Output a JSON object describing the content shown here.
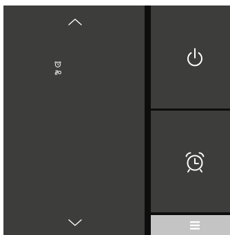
{
  "colors": {
    "panel": "#3d3d3b",
    "background": "#0d0d0d",
    "icon": "#ffffff",
    "menu_bar": "#c4c4c4"
  },
  "left_panel": {
    "up_icon": "chevron-up-icon",
    "down_icon": "chevron-down-icon",
    "status_icons": [
      "alarm-clock-icon",
      "fan-icon"
    ]
  },
  "right_panel": {
    "buttons": [
      {
        "name": "power-button",
        "icon": "power-icon"
      },
      {
        "name": "alarm-button",
        "icon": "alarm-clock-icon"
      }
    ]
  },
  "menu_bar": {
    "icon": "hamburger-menu-icon"
  }
}
